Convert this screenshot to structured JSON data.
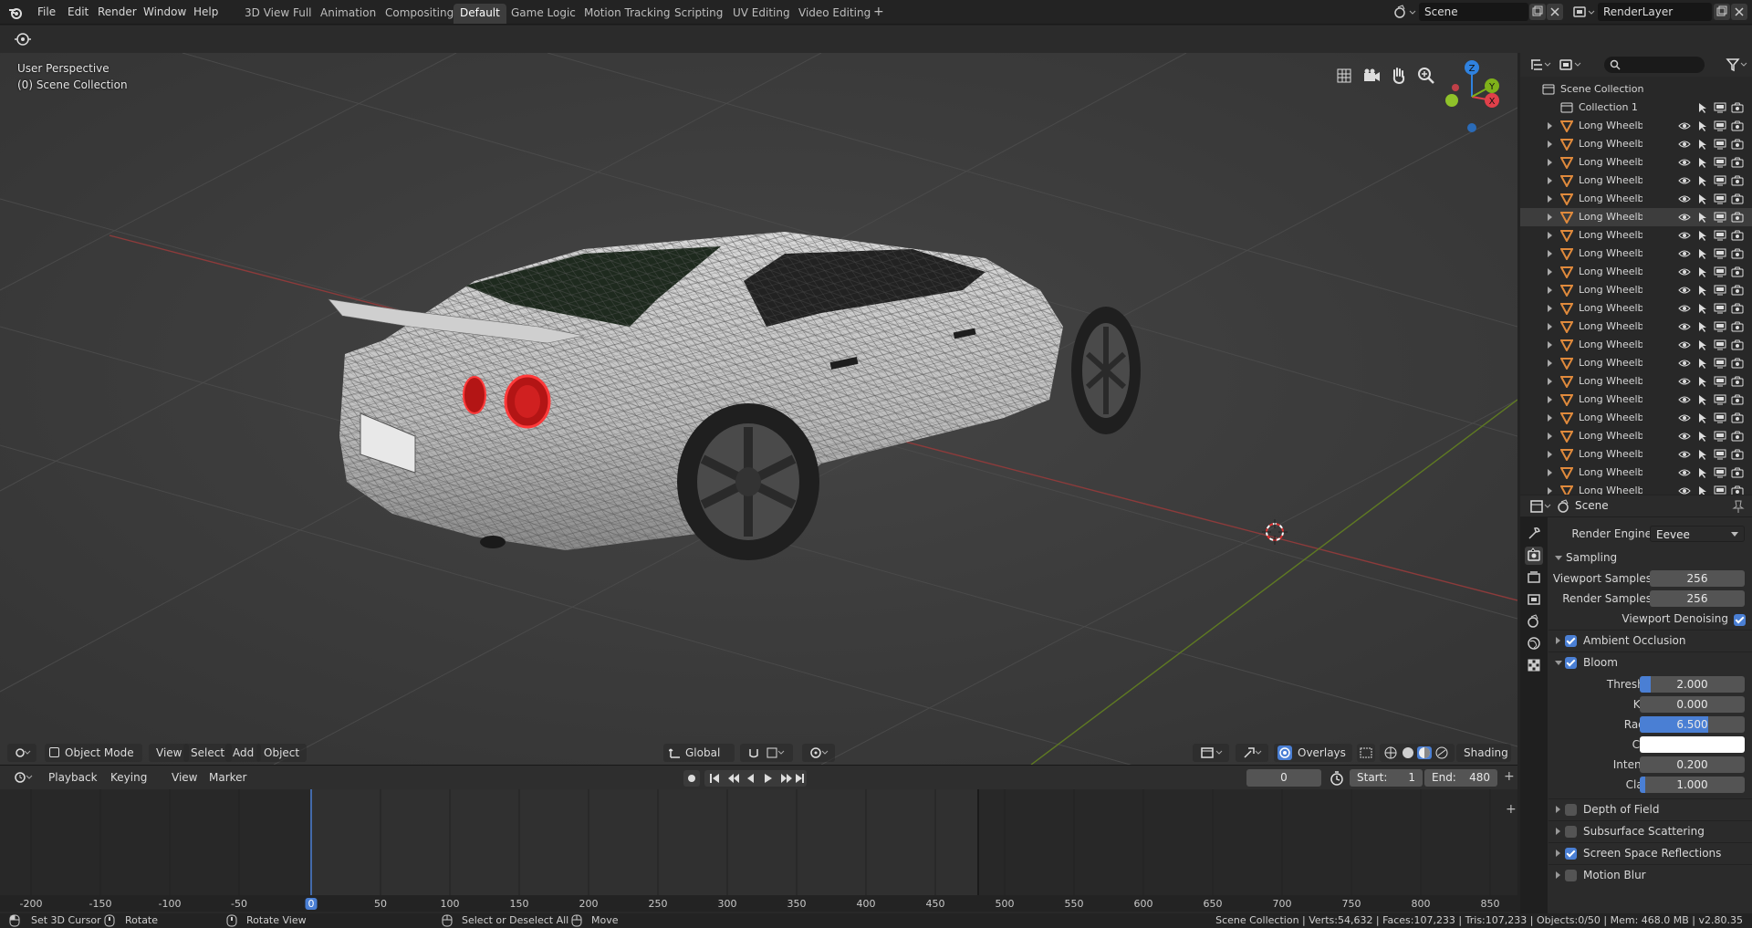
{
  "top_menu": {
    "items": [
      "File",
      "Edit",
      "Render",
      "Window",
      "Help"
    ]
  },
  "workspaces": {
    "tabs": [
      "3D View Full",
      "Animation",
      "Compositing",
      "Default",
      "Game Logic",
      "Motion Tracking",
      "Scripting",
      "UV Editing",
      "Video Editing"
    ],
    "active": "Default",
    "add_label": "+"
  },
  "scene_selector": {
    "value": "Scene"
  },
  "render_layer_selector": {
    "value": "RenderLayer"
  },
  "viewport": {
    "perspective_label": "User Perspective",
    "collection_label": "(0) Scene Collection",
    "gizmo_axes": [
      "Z",
      "Y",
      "X"
    ],
    "header": {
      "mode": "Object Mode",
      "menus": [
        "View",
        "Select",
        "Add",
        "Object"
      ],
      "transform_orientation": "Global",
      "overlays_label": "Overlays",
      "shading_label": "Shading"
    }
  },
  "timeline": {
    "menus": [
      "Playback",
      "Keying",
      "View",
      "Marker"
    ],
    "current_frame": "0",
    "start_label": "Start:",
    "start_value": "1",
    "end_label": "End:",
    "end_value": "480",
    "ruler_ticks": [
      "-200",
      "-150",
      "-100",
      "-50",
      "0",
      "50",
      "100",
      "150",
      "200",
      "250",
      "300",
      "350",
      "400",
      "450",
      "500",
      "550",
      "600",
      "650",
      "700",
      "750",
      "800",
      "850"
    ],
    "playhead_label": "0"
  },
  "statusbar": {
    "set_cursor": "Set 3D Cursor",
    "rotate": "Rotate",
    "rotate_view": "Rotate View",
    "select_all": "Select or Deselect All",
    "move": "Move",
    "stats": "Scene Collection | Verts:54,632 | Faces:107,233 | Tris:107,233 | Objects:0/50 | Mem: 468.0 MB | v2.80.35"
  },
  "outliner": {
    "root": "Scene Collection",
    "collection": "Collection 1",
    "object_name": "Long Wheelbase Car",
    "object_count": 21,
    "selected_index": 5
  },
  "properties": {
    "header_title": "Scene",
    "render_engine_label": "Render Engine",
    "render_engine_value": "Eevee",
    "sampling": {
      "title": "Sampling",
      "viewport_samples_label": "Viewport Samples",
      "viewport_samples": "256",
      "render_samples_label": "Render Samples",
      "render_samples": "256",
      "viewport_denoising_label": "Viewport Denoising"
    },
    "ambient_occlusion": "Ambient Occlusion",
    "bloom": {
      "title": "Bloom",
      "threshold_label": "Threshold",
      "threshold": "2.000",
      "threshold_fill": 0.1,
      "knee_label": "Knee",
      "knee": "0.000",
      "radius_label": "Radius",
      "radius": "6.500",
      "radius_fill": 0.65,
      "color_label": "Color",
      "color": "#ffffff",
      "intensity_label": "Intensity",
      "intensity": "0.200",
      "clamp_label": "Clamp",
      "clamp": "1.000",
      "clamp_fill": 0.05
    },
    "depth_of_field": "Depth of Field",
    "subsurface_scattering": "Subsurface Scattering",
    "screen_space_reflections": "Screen Space Reflections",
    "motion_blur": "Motion Blur"
  },
  "colors": {
    "accent": "#4a7fd4",
    "object_icon": "#e08a3c",
    "x_axis": "#e0404a",
    "y_axis": "#7fb11a",
    "z_axis": "#2f82e0"
  }
}
